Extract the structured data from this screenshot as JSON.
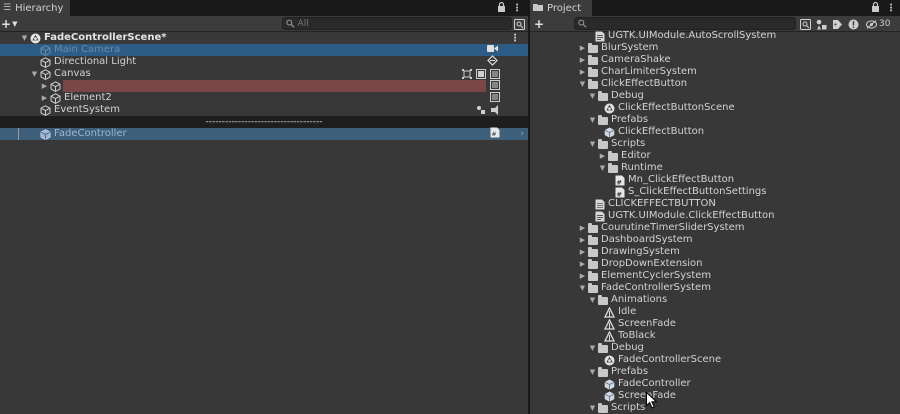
{
  "hierarchy": {
    "tab_title": "Hierarchy",
    "search_placeholder": "All",
    "scene_name": "FadeControllerScene*",
    "items": {
      "main_camera": "Main Camera",
      "directional_light": "Directional Light",
      "canvas": "Canvas",
      "element2": "Element2",
      "event_system": "EventSystem",
      "separator": "------------------------------------",
      "fade_controller": "FadeController"
    }
  },
  "project": {
    "tab_title": "Project",
    "hidden_count": "30",
    "rows": [
      {
        "label": "UGTK.UIModule.AutoScrollSystem",
        "kind": "asmdef"
      },
      {
        "label": "BlurSystem",
        "kind": "folder-closed"
      },
      {
        "label": "CameraShake",
        "kind": "folder-closed"
      },
      {
        "label": "CharLimiterSystem",
        "kind": "folder-closed"
      },
      {
        "label": "ClickEffectButton",
        "kind": "folder-open"
      },
      {
        "label": "Debug",
        "kind": "folder-open"
      },
      {
        "label": "ClickEffectButtonScene",
        "kind": "scene"
      },
      {
        "label": "Prefabs",
        "kind": "folder-open"
      },
      {
        "label": "ClickEffectButton",
        "kind": "prefab"
      },
      {
        "label": "Scripts",
        "kind": "folder-open"
      },
      {
        "label": "Editor",
        "kind": "folder-closed"
      },
      {
        "label": "Runtime",
        "kind": "folder-open"
      },
      {
        "label": "Mn_ClickEffectButton",
        "kind": "script"
      },
      {
        "label": "S_ClickEffectButtonSettings",
        "kind": "script"
      },
      {
        "label": "CLICKEFFECTBUTTON",
        "kind": "doc"
      },
      {
        "label": "UGTK.UIModule.ClickEffectButton",
        "kind": "asmdef"
      },
      {
        "label": "CourutineTimerSliderSystem",
        "kind": "folder-closed"
      },
      {
        "label": "DashboardSystem",
        "kind": "folder-closed"
      },
      {
        "label": "DrawingSystem",
        "kind": "folder-closed"
      },
      {
        "label": "DropDownExtension",
        "kind": "folder-closed"
      },
      {
        "label": "ElementCyclerSystem",
        "kind": "folder-closed"
      },
      {
        "label": "FadeControllerSystem",
        "kind": "folder-open"
      },
      {
        "label": "Animations",
        "kind": "folder-open"
      },
      {
        "label": "Idle",
        "kind": "anim"
      },
      {
        "label": "ScreenFade",
        "kind": "anim"
      },
      {
        "label": "ToBlack",
        "kind": "anim"
      },
      {
        "label": "Debug",
        "kind": "folder-open"
      },
      {
        "label": "FadeControllerScene",
        "kind": "scene"
      },
      {
        "label": "Prefabs",
        "kind": "folder-open"
      },
      {
        "label": "FadeController",
        "kind": "prefab"
      },
      {
        "label": "ScreenFade",
        "kind": "prefab"
      },
      {
        "label": "Scripts",
        "kind": "folder-open"
      }
    ]
  },
  "colors": {
    "panel_bg": "#383838",
    "tab_bg": "#3c3c3c",
    "selection_blue": "#2c5d87",
    "drag_blue": "#3e5f7a",
    "highlight_red": "#7a4646",
    "text": "#d2d2d2"
  }
}
